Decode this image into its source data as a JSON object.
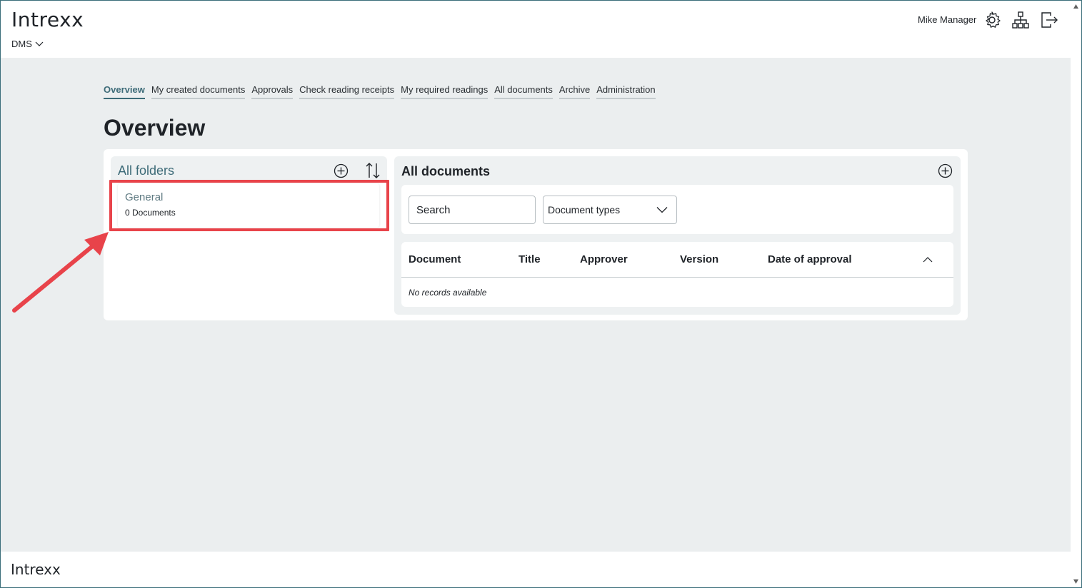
{
  "header": {
    "logo": "Intrexx",
    "app_name": "DMS",
    "user_name": "Mike Manager",
    "icons": [
      "gear-icon",
      "sitemap-icon",
      "logout-icon"
    ]
  },
  "tabs": [
    {
      "label": "Overview",
      "active": true
    },
    {
      "label": "My created documents",
      "active": false
    },
    {
      "label": "Approvals",
      "active": false
    },
    {
      "label": "Check reading receipts",
      "active": false
    },
    {
      "label": "My required readings",
      "active": false
    },
    {
      "label": "All documents",
      "active": false
    },
    {
      "label": "Archive",
      "active": false
    },
    {
      "label": "Administration",
      "active": false
    }
  ],
  "page": {
    "title": "Overview"
  },
  "folders": {
    "title": "All folders",
    "items": [
      {
        "name": "General",
        "count": "0 Documents"
      }
    ]
  },
  "documents": {
    "title": "All documents",
    "search_placeholder": "Search",
    "document_types_label": "Document types",
    "columns": [
      "Document",
      "Title",
      "Approver",
      "Version",
      "Date of approval"
    ],
    "empty_text": "No records available"
  },
  "footer": {
    "logo": "Intrexx"
  },
  "colors": {
    "accent": "#3d6b78",
    "highlight": "#e8434a",
    "background": "#ebeeef"
  }
}
